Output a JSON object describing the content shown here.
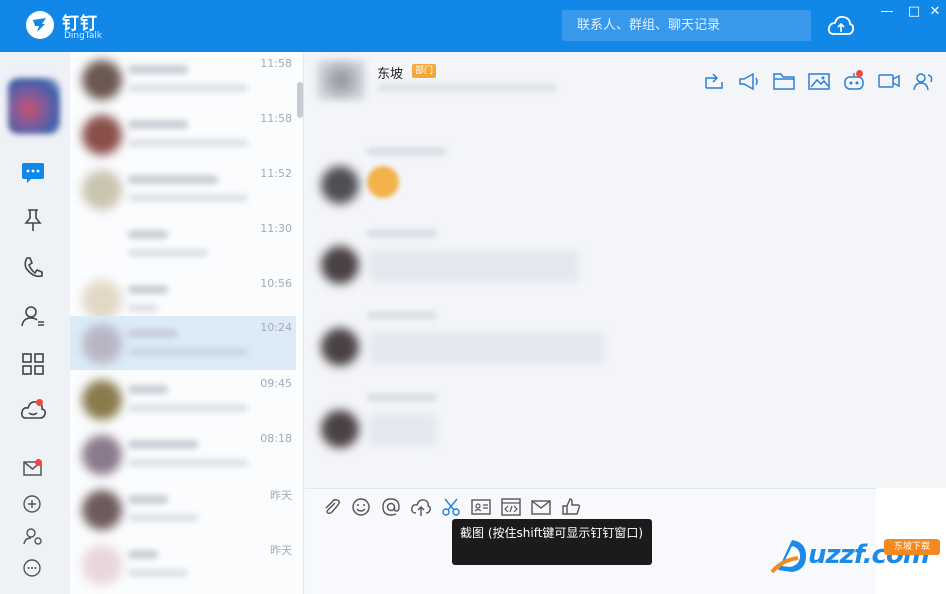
{
  "app": {
    "name": "钉钉",
    "subtitle": "DingTalk"
  },
  "search": {
    "placeholder": "联系人、群组、聊天记录"
  },
  "window_controls": {
    "minimize": "—",
    "maximize": "□",
    "close": "✕"
  },
  "conversations": [
    {
      "time": "11:58",
      "active": false
    },
    {
      "time": "11:58",
      "active": false
    },
    {
      "time": "11:52",
      "active": false
    },
    {
      "time": "11:30",
      "active": false
    },
    {
      "time": "10:56",
      "active": false
    },
    {
      "time": "10:24",
      "active": true
    },
    {
      "time": "09:45",
      "active": false
    },
    {
      "time": "08:18",
      "active": false
    },
    {
      "time": "昨天",
      "active": false
    },
    {
      "time": "昨天",
      "active": false
    }
  ],
  "chat": {
    "name": "东坡",
    "badge": "部门"
  },
  "tooltip": {
    "text": "截图 (按住shift键可显示钉钉窗口)"
  },
  "watermark": {
    "text": "uzzf.com",
    "tag": "东坡下载"
  },
  "colors": {
    "brand": "#1187e8",
    "badge": "#f3a83c",
    "notify": "#f2473f",
    "active_row": "#ddebf8"
  }
}
